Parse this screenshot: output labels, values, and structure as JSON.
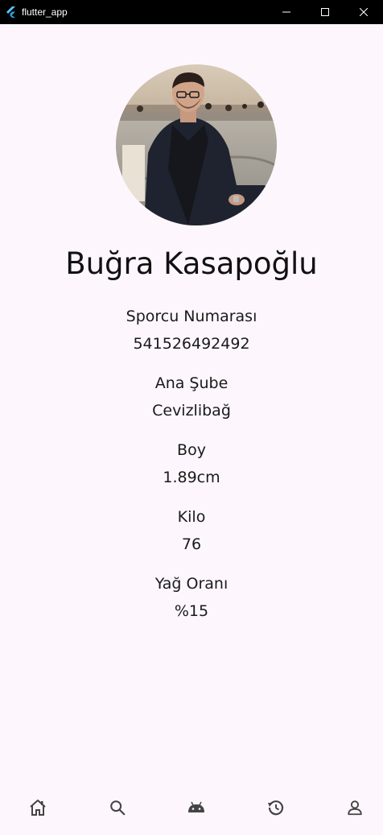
{
  "window": {
    "title": "flutter_app",
    "controls": [
      "minimize-icon",
      "maximize-icon",
      "close-icon"
    ]
  },
  "profile": {
    "name": "Buğra Kasapoğlu",
    "fields": [
      {
        "label": "Sporcu Numarası",
        "value": "541526492492"
      },
      {
        "label": "Ana Şube",
        "value": "Cevizlibağ"
      },
      {
        "label": "Boy",
        "value": "1.89cm"
      },
      {
        "label": "Kilo",
        "value": "76"
      },
      {
        "label": "Yağ Oranı",
        "value": "%15"
      }
    ]
  },
  "nav": {
    "items": [
      {
        "icon": "home-icon"
      },
      {
        "icon": "search-icon"
      },
      {
        "icon": "android-icon"
      },
      {
        "icon": "history-icon"
      },
      {
        "icon": "person-icon"
      }
    ]
  },
  "colors": {
    "background": "#fdf7fd",
    "titlebar": "#000000",
    "text": "#1a1a1a",
    "icon": "#444444"
  }
}
